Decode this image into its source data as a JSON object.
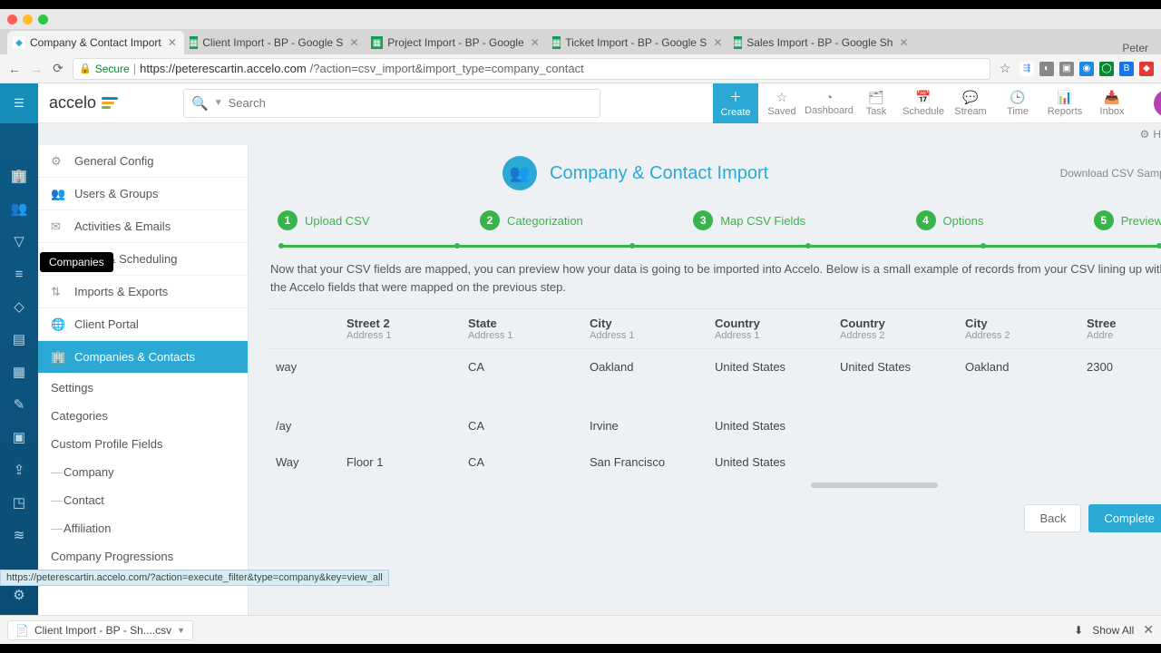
{
  "browser": {
    "user": "Peter",
    "tabs": [
      {
        "title": "Company & Contact Import",
        "active": true,
        "fav": "accelo"
      },
      {
        "title": "Client Import - BP - Google S",
        "active": false,
        "fav": "sheets"
      },
      {
        "title": "Project Import - BP - Google",
        "active": false,
        "fav": "sheets"
      },
      {
        "title": "Ticket Import - BP - Google S",
        "active": false,
        "fav": "sheets"
      },
      {
        "title": "Sales Import - BP - Google Sh",
        "active": false,
        "fav": "sheets"
      }
    ],
    "secure_label": "Secure",
    "url_domain": "https://peterescartin.accelo.com",
    "url_path": "/?action=csv_import&import_type=company_contact"
  },
  "appbar": {
    "logo": "accelo",
    "search_placeholder": "Search",
    "items": [
      {
        "label": "Create",
        "key": "create"
      },
      {
        "label": "Saved",
        "key": "saved"
      },
      {
        "label": "Dashboard",
        "key": "dashboard"
      },
      {
        "label": "Task",
        "key": "task"
      },
      {
        "label": "Schedule",
        "key": "schedule"
      },
      {
        "label": "Stream",
        "key": "stream"
      },
      {
        "label": "Time",
        "key": "time"
      },
      {
        "label": "Reports",
        "key": "reports"
      },
      {
        "label": "Inbox",
        "key": "inbox"
      }
    ],
    "avatar": "P"
  },
  "help_label": "Help",
  "tooltip": "Companies",
  "sidenav": {
    "items": [
      {
        "label": "General Config"
      },
      {
        "label": "Users & Groups"
      },
      {
        "label": "Activities & Emails"
      },
      {
        "label": "Tasks & Scheduling"
      },
      {
        "label": "Imports & Exports"
      },
      {
        "label": "Client Portal"
      },
      {
        "label": "Companies & Contacts",
        "active": true
      }
    ],
    "subs": [
      {
        "label": "Settings"
      },
      {
        "label": "Categories"
      },
      {
        "label": "Custom Profile Fields"
      },
      {
        "label": "Company",
        "indent": true
      },
      {
        "label": "Contact",
        "indent": true
      },
      {
        "label": "Affiliation",
        "indent": true
      },
      {
        "label": "Company Progressions"
      }
    ]
  },
  "page": {
    "title": "Company & Contact Import",
    "download_link": "Download CSV Sample",
    "steps": [
      {
        "n": "1",
        "label": "Upload CSV"
      },
      {
        "n": "2",
        "label": "Categorization"
      },
      {
        "n": "3",
        "label": "Map CSV Fields"
      },
      {
        "n": "4",
        "label": "Options"
      },
      {
        "n": "5",
        "label": "Preview"
      }
    ],
    "desc": "Now that your CSV fields are mapped, you can preview how your data is going to be imported into Accelo. Below is a small example of records from your CSV lining up with the Accelo fields that were mapped on the previous step.",
    "columns": [
      {
        "h1": "",
        "h2": ""
      },
      {
        "h1": "Street 2",
        "h2": "Address 1"
      },
      {
        "h1": "State",
        "h2": "Address 1"
      },
      {
        "h1": "City",
        "h2": "Address 1"
      },
      {
        "h1": "Country",
        "h2": "Address 1"
      },
      {
        "h1": "Country",
        "h2": "Address 2"
      },
      {
        "h1": "City",
        "h2": "Address 2"
      },
      {
        "h1": "Stree",
        "h2": "Addre"
      }
    ],
    "rows": [
      [
        "way",
        "",
        "CA",
        "Oakland",
        "United States",
        "United States",
        "Oakland",
        "2300"
      ],
      [
        "",
        "",
        "",
        "",
        "",
        "",
        "",
        ""
      ],
      [
        "/ay",
        "",
        "CA",
        "Irvine",
        "United States",
        "",
        "",
        ""
      ],
      [
        " Way",
        "Floor 1",
        "CA",
        "San Francisco",
        "United States",
        "",
        "",
        ""
      ]
    ],
    "back_label": "Back",
    "complete_label": "Complete"
  },
  "status_url": "https://peterescartin.accelo.com/?action=execute_filter&type=company&key=view_all",
  "download": {
    "file": "Client Import - BP - Sh....csv",
    "show_all": "Show All"
  }
}
